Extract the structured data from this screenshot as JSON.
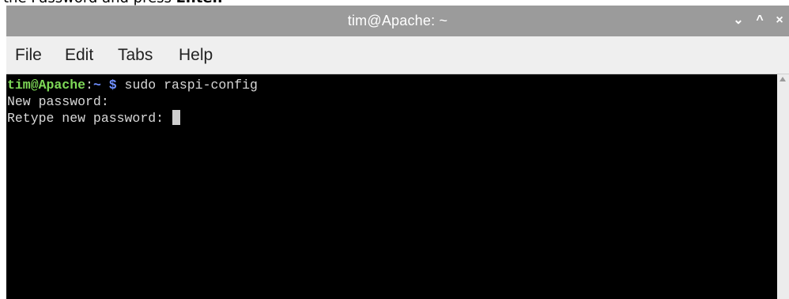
{
  "caption": {
    "text_before": "the Password and press ",
    "text_bold": "Enter."
  },
  "window": {
    "title": "tim@Apache: ~",
    "buttons": {
      "minimize": "⌄",
      "maximize": "^",
      "close": "×"
    }
  },
  "menu": {
    "file": "File",
    "edit": "Edit",
    "tabs": "Tabs",
    "help": "Help"
  },
  "terminal": {
    "prompt_user_host": "tim@Apache",
    "prompt_sep": ":",
    "prompt_path": "~",
    "prompt_sign": " $",
    "command": " sudo raspi-config",
    "line2": "New password:",
    "line3": "Retype new password: "
  },
  "colors": {
    "titlebar": "#9b9b9b",
    "menubar": "#efefef",
    "terminal_bg": "#000000",
    "user_host": "#7ed957",
    "path": "#6f8fff",
    "text": "#d8d8d8"
  }
}
